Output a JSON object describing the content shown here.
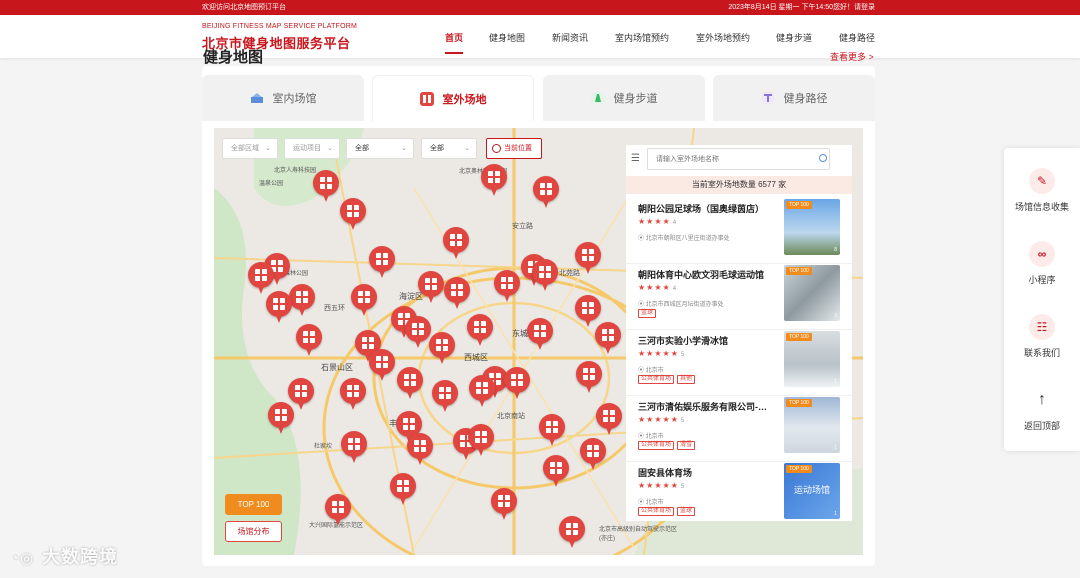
{
  "topbar": {
    "welcome": "欢迎访问北京地图预订平台",
    "info": "2023年8月14日 星期一 下午14:50您好！请登录"
  },
  "logo": {
    "en": "BEIJING FITNESS MAP SERVICE PLATFORM",
    "cn": "北京市健身地图服务平台"
  },
  "nav": [
    "首页",
    "健身地图",
    "新闻资讯",
    "室内场馆预约",
    "室外场地预约",
    "健身步道",
    "健身路径"
  ],
  "section": {
    "title": "健身地图",
    "more": "查看更多 >"
  },
  "tabs": [
    "室内场馆",
    "室外场地",
    "健身步道",
    "健身路径"
  ],
  "filters": [
    "全部区域",
    "运动项目",
    "全部",
    "全部"
  ],
  "locate_label": "当前位置",
  "map_labels": [
    "北京人寿科技园",
    "温泉公园",
    "安立路",
    "北苑路",
    "北京西山国家森林公园",
    "西五环",
    "海淀区",
    "石景山区",
    "西城区",
    "东城区",
    "北京南站",
    "丰台区",
    "杜家坎",
    "大兴国际氢能示范区",
    "北京市高级别自动驾驶示范区(亦庄)",
    "北京奥林匹克公园"
  ],
  "top100_label": "TOP 100",
  "distribution_label": "场馆分布",
  "panel": {
    "search_placeholder": "请输入室外场地名称",
    "count_text": "当前室外场地数量 6577 家",
    "items": [
      {
        "name": "朝阳公园足球场（国奥绿茵店）",
        "score": "4",
        "address": "北京市朝阳区八里庄街道办事处",
        "tags": [],
        "thumb_badge": "TOP 100",
        "thumb_count": "8",
        "thumb_text": ""
      },
      {
        "name": "朝阳体育中心欧文羽毛球运动馆",
        "score": "4",
        "address": "北京市西城区月坛街道办事处",
        "tags": [
          "篮球"
        ],
        "thumb_badge": "TOP 100",
        "thumb_count": "3",
        "thumb_text": ""
      },
      {
        "name": "三河市实验小学滑冰馆",
        "score": "5",
        "address": "北京市",
        "tags": [
          "公共体育场",
          "其他"
        ],
        "thumb_badge": "TOP 100",
        "thumb_count": "1",
        "thumb_text": ""
      },
      {
        "name": "三河市清佑娱乐服务有限公司-…",
        "score": "5",
        "address": "北京市",
        "tags": [
          "公共体育场",
          "滑雪"
        ],
        "thumb_badge": "TOP 100",
        "thumb_count": "1",
        "thumb_text": ""
      },
      {
        "name": "固安县体育场",
        "score": "5",
        "address": "北京市",
        "tags": [
          "公共体育场",
          "篮球"
        ],
        "thumb_badge": "TOP 100",
        "thumb_count": "1",
        "thumb_text": "运动场馆"
      }
    ]
  },
  "floatbar": [
    "场馆信息收集",
    "小程序",
    "联系我们",
    "返回顶部"
  ],
  "watermark": "大数跨境",
  "colors": {
    "brand_red": "#c8161d",
    "pin_red": "#e0463f",
    "badge_orange": "#f08c1e"
  }
}
